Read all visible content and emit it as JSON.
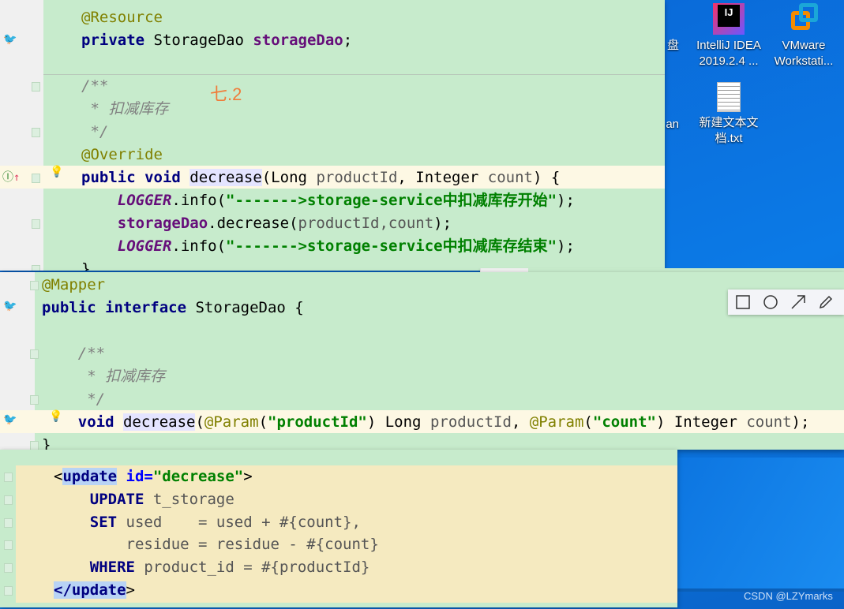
{
  "desktop": {
    "icons": [
      {
        "label": "盘"
      },
      {
        "label": "IntelliJ IDEA 2019.2.4 ..."
      },
      {
        "label": "VMware Workstati..."
      },
      {
        "label": "an"
      },
      {
        "label": "新建文本文档.txt"
      }
    ],
    "watermark": "CSDN @LZYmarks"
  },
  "annotation_label": "七.2",
  "panel1": {
    "lines": [
      [
        [
          "@Resource",
          "an"
        ]
      ],
      [
        [
          "private ",
          "kw"
        ],
        [
          "StorageDao ",
          "pl"
        ],
        [
          "storageDao",
          "fd"
        ],
        [
          ";",
          "pl"
        ]
      ],
      [
        [
          "/**",
          "cm"
        ]
      ],
      [
        [
          " * 扣减库存",
          "cm"
        ]
      ],
      [
        [
          " */",
          "cm"
        ]
      ],
      [
        [
          "@Override",
          "an"
        ]
      ],
      [
        [
          "public void ",
          "kw"
        ],
        [
          "decrease",
          "mt"
        ],
        [
          "(Long ",
          "pl"
        ],
        [
          "productId",
          "pm"
        ],
        [
          ", Integer ",
          "pl"
        ],
        [
          "count",
          "pm"
        ],
        [
          ") {",
          "pl"
        ]
      ],
      [
        [
          "    ",
          "pl"
        ],
        [
          "LOGGER",
          "sf"
        ],
        [
          ".info(",
          "pl"
        ],
        [
          "\"------->storage-service中扣减库存开始\"",
          "st"
        ],
        [
          ");",
          "pl"
        ]
      ],
      [
        [
          "    ",
          "pl"
        ],
        [
          "storageDao",
          "fd"
        ],
        [
          ".decrease(",
          "pl"
        ],
        [
          "productId,count",
          "pm"
        ],
        [
          ");",
          "pl"
        ]
      ],
      [
        [
          "    ",
          "pl"
        ],
        [
          "LOGGER",
          "sf"
        ],
        [
          ".info(",
          "pl"
        ],
        [
          "\"------->storage-service中扣减库存结束\"",
          "st"
        ],
        [
          ");",
          "pl"
        ]
      ],
      [
        [
          "}",
          "pl"
        ]
      ]
    ]
  },
  "panel2": {
    "lines": [
      [
        [
          "@Mapper",
          "an"
        ]
      ],
      [
        [
          "public interface ",
          "kw"
        ],
        [
          "StorageDao {",
          "pl"
        ]
      ],
      [
        [
          "    /**",
          "cm"
        ]
      ],
      [
        [
          "     * 扣减库存",
          "cm"
        ]
      ],
      [
        [
          "     */",
          "cm"
        ]
      ],
      [
        [
          "    void ",
          "kw"
        ],
        [
          "decrease",
          "mt"
        ],
        [
          "(",
          "pl"
        ],
        [
          "@Param",
          "an"
        ],
        [
          "(",
          "pl"
        ],
        [
          "\"productId\"",
          "st"
        ],
        [
          ") Long ",
          "pl"
        ],
        [
          "productId",
          "pm"
        ],
        [
          ", ",
          "pl"
        ],
        [
          "@Param",
          "an"
        ],
        [
          "(",
          "pl"
        ],
        [
          "\"count\"",
          "st"
        ],
        [
          ") Integer ",
          "pl"
        ],
        [
          "count",
          "pm"
        ],
        [
          ");",
          "pl"
        ]
      ],
      [
        [
          "}",
          "pl"
        ]
      ]
    ]
  },
  "panel3": {
    "lines": [
      [
        [
          "<",
          "pl"
        ],
        [
          "update",
          "tg"
        ],
        [
          " id=",
          "at"
        ],
        [
          "\"decrease\"",
          "st"
        ],
        [
          ">",
          "pl"
        ]
      ],
      [
        [
          "    UPDATE ",
          "xk"
        ],
        [
          "t_storage",
          "pm"
        ]
      ],
      [
        [
          "    SET ",
          "xk"
        ],
        [
          "used    = used + #{count},",
          "pm"
        ]
      ],
      [
        [
          "        residue = residue - #{count}",
          "pm"
        ]
      ],
      [
        [
          "    WHERE ",
          "xk"
        ],
        [
          "product_id = #{productId}",
          "pm"
        ]
      ],
      [
        [
          "</",
          "tg"
        ],
        [
          "update",
          "tg"
        ],
        [
          ">",
          "pl"
        ]
      ]
    ]
  },
  "toolbar": {
    "tools": [
      "rectangle-tool",
      "circle-tool",
      "arrow-tool",
      "pen-tool"
    ]
  },
  "colors": {
    "editor_bg": "#c7ebcc",
    "xml_bg": "#f5eac0",
    "desktop": "#0b7ae6"
  }
}
